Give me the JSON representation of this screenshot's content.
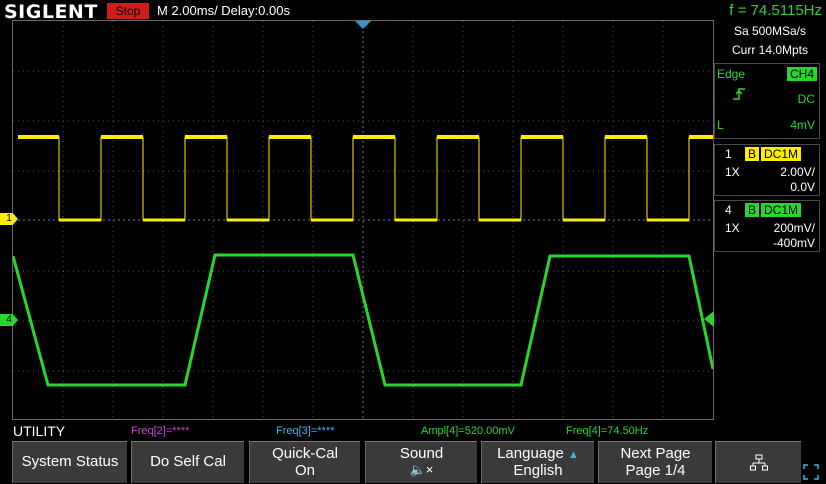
{
  "header": {
    "brand": "SIGLENT",
    "run_state": "Stop",
    "timebase": "M 2.00ms/ Delay:0.00s",
    "frequency": "f = 74.5115Hz"
  },
  "acquisition": {
    "sample_rate": "Sa 500MSa/s",
    "memory_depth": "Curr 14.0Mpts"
  },
  "trigger": {
    "type": "Edge",
    "source": "CH4",
    "coupling": "DC",
    "slope_label": "L",
    "level": "4mV"
  },
  "channels": [
    {
      "number": "1",
      "bw": "B",
      "coupling": "DC1M",
      "probe": "1X",
      "scale": "2.00V/",
      "offset": "0.0V",
      "color": "#ffeb00"
    },
    {
      "number": "4",
      "bw": "B",
      "coupling": "DC1M",
      "probe": "1X",
      "scale": "200mV/",
      "offset": "-400mV",
      "color": "#27d72b"
    }
  ],
  "markers": {
    "ch1": "1",
    "ch4": "4"
  },
  "menu_title": "UTILITY",
  "measurements": [
    {
      "text": "Freq[2]=****",
      "color": "#cc44cc"
    },
    {
      "text": "Freq[3]=****",
      "color": "#3fb6e6"
    },
    {
      "text": "Ampl[4]=520.00mV",
      "color": "#27d72b"
    },
    {
      "text": "Freq[4]=74.50Hz",
      "color": "#27d72b"
    }
  ],
  "softkeys": [
    {
      "line1": "System Status",
      "line2": ""
    },
    {
      "line1": "Do Self Cal",
      "line2": ""
    },
    {
      "line1": "Quick-Cal",
      "line2": "On"
    },
    {
      "line1": "Sound",
      "line2": "🔈×"
    },
    {
      "line1": "Language",
      "line2": "English"
    },
    {
      "line1": "Next Page",
      "line2": "Page 1/4"
    }
  ],
  "colors": {
    "ch1": "#ffeb00",
    "ch4": "#27d72b",
    "stop": "#d21b1b",
    "trigger_marker": "#1e9ed8"
  }
}
